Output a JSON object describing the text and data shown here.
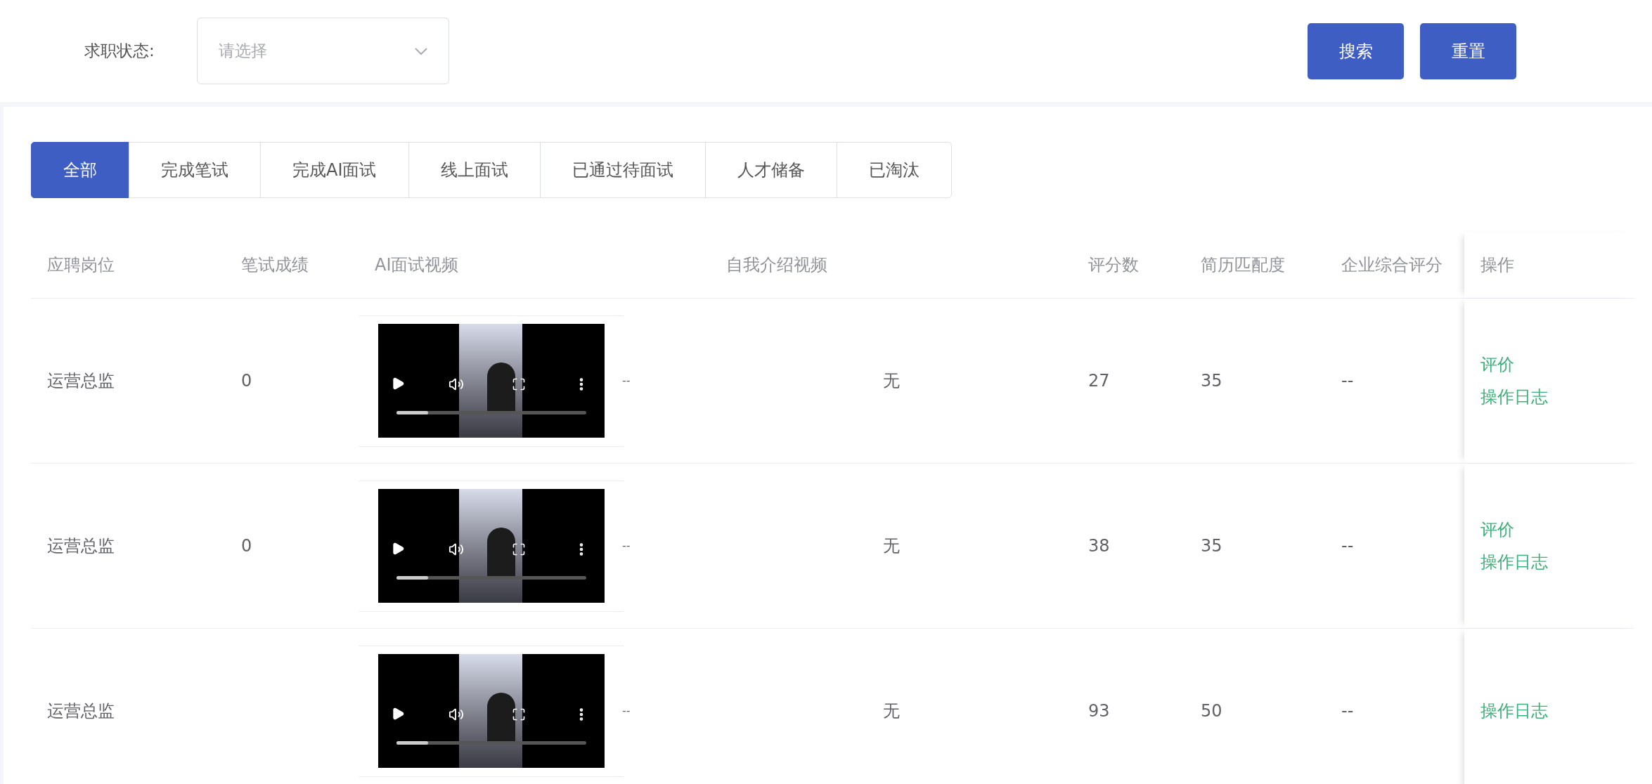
{
  "filter": {
    "label": "求职状态:",
    "select": {
      "placeholder": "请选择"
    }
  },
  "buttons": [
    {
      "label": "搜索"
    },
    {
      "label": "重置"
    }
  ],
  "tabs": [
    {
      "label": "全部",
      "selected": true
    },
    {
      "label": "完成笔试",
      "selected": false
    },
    {
      "label": "完成AI面试",
      "selected": false
    },
    {
      "label": "线上面试",
      "selected": false
    },
    {
      "label": "已通过待面试",
      "selected": false
    },
    {
      "label": "人才储备",
      "selected": false
    },
    {
      "label": "已淘汰",
      "selected": false
    }
  ],
  "table": {
    "columns": [
      "应聘岗位",
      "笔试成绩",
      "AI面试视频",
      "自我介绍视频",
      "评分数",
      "简历匹配度",
      "企业综合评分",
      "操作"
    ],
    "rows": [
      {
        "position": "运营总监",
        "written_score": "0",
        "ai_video": {
          "level": 0.17,
          "trailing": "--"
        },
        "intro_video": "无",
        "rating_count": "27",
        "resume_match": "35",
        "company_score": "--",
        "actions": [
          "评价",
          "操作日志"
        ]
      },
      {
        "position": "运营总监",
        "written_score": "0",
        "ai_video": {
          "level": 0.17,
          "trailing": "--"
        },
        "intro_video": "无",
        "rating_count": "38",
        "resume_match": "35",
        "company_score": "--",
        "actions": [
          "评价",
          "操作日志"
        ]
      },
      {
        "position": "运营总监",
        "ai_video": {
          "level": 0.17,
          "trailing": "--"
        },
        "intro_video": "无",
        "rating_count": "93",
        "resume_match": "50",
        "company_score": "--",
        "actions": [
          "操作日志"
        ]
      }
    ]
  }
}
